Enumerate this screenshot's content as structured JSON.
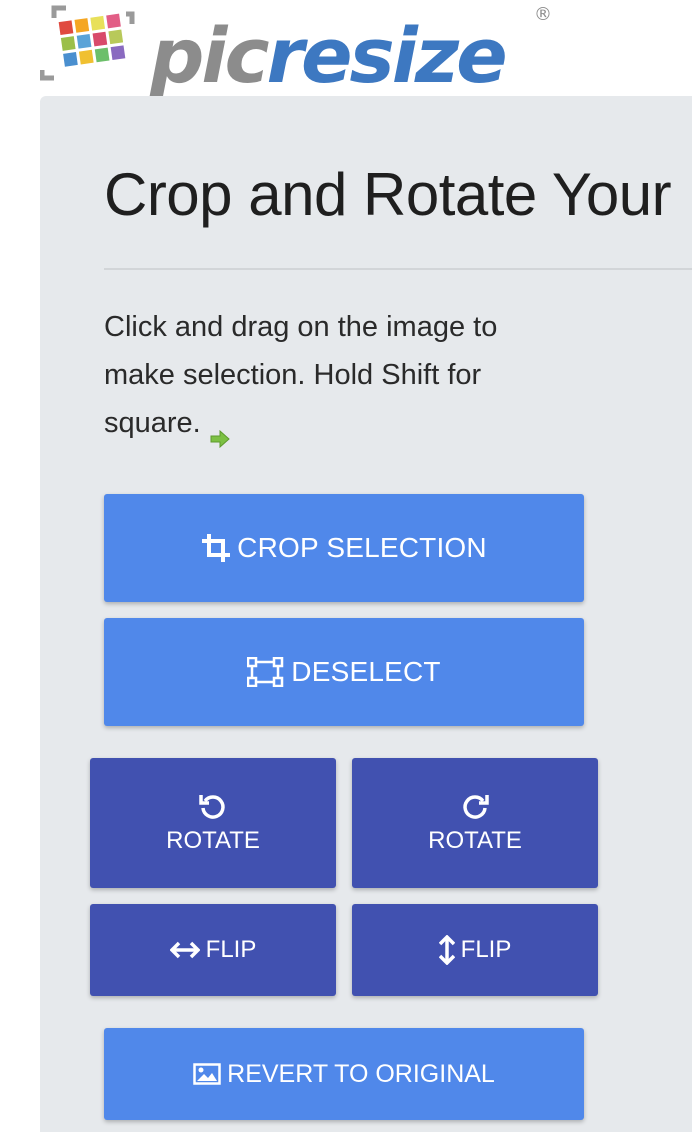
{
  "logo": {
    "text_part1": "pic",
    "text_part2": "resize",
    "registered": "®"
  },
  "heading": "Crop and Rotate Your",
  "instructions": "Click and drag on the image to make selection. Hold Shift for square.",
  "buttons": {
    "crop": "CROP SELECTION",
    "deselect": "DESELECT",
    "rotate_left": "ROTATE",
    "rotate_right": "ROTATE",
    "flip_horizontal": "FLIP",
    "flip_vertical": "FLIP",
    "revert": "REVERT TO ORIGINAL"
  },
  "icons": {
    "logo": "picresize-logo-icon",
    "next": "green-arrow-icon",
    "crop": "crop-icon",
    "deselect": "deselect-icon",
    "rotate_left": "rotate-left-icon",
    "rotate_right": "rotate-right-icon",
    "flip_horizontal": "arrows-horizontal-icon",
    "flip_vertical": "arrows-vertical-icon",
    "revert": "image-icon"
  },
  "colors": {
    "primary_button": "#5088ea",
    "secondary_button": "#4151b0",
    "panel_background": "#e6e9ec",
    "logo_gray": "#8c8c8c",
    "logo_blue": "#3d78c1",
    "accent_green": "#7cc043"
  }
}
